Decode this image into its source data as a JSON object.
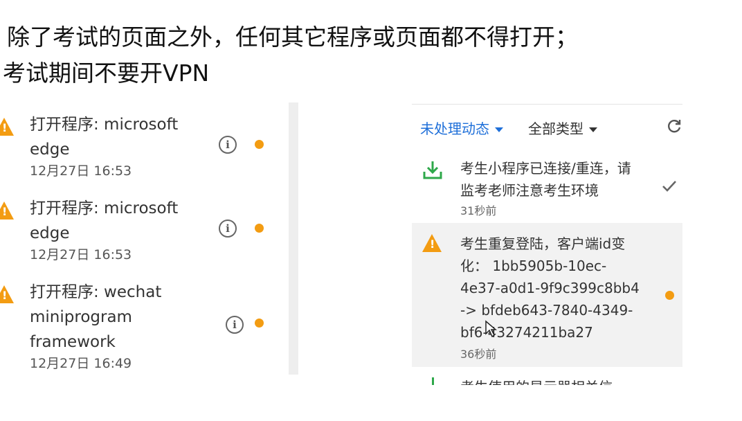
{
  "heading": {
    "line1": "除了考试的页面之外，任何其它程序或页面都不得打开；",
    "line2": "考试期间不要开VPN"
  },
  "left_events": [
    {
      "title_line1": "打开程序: microsoft",
      "title_line2": "edge",
      "title_line3": "",
      "time": "12月27日 16:53"
    },
    {
      "title_line1": "打开程序: microsoft",
      "title_line2": "edge",
      "title_line3": "",
      "time": "12月27日 16:53"
    },
    {
      "title_line1": "打开程序: wechat",
      "title_line2": "miniprogram",
      "title_line3": "framework",
      "time": "12月27日 16:49"
    }
  ],
  "right_panel": {
    "filter_status": "未处理动态",
    "filter_type": "全部类型",
    "events": [
      {
        "lines": [
          "考生小程序已连接/重连，请",
          "监考老师注意考生环境"
        ],
        "time": "31秒前"
      },
      {
        "lines": [
          "考生重复登陆，客户端id变",
          "化：  1bb5905b-10ec-",
          "4e37-a0d1-9f9c399c8bb4",
          "-> bfdeb643-7840-4349-",
          "bf6-43274211ba27"
        ],
        "time": "36秒前"
      },
      {
        "lines": [
          "考生使用的显示器相关信"
        ],
        "time": ""
      }
    ]
  },
  "colors": {
    "accent": "#1e6fd9",
    "warning": "#f39c12",
    "success": "#2ea84a"
  }
}
